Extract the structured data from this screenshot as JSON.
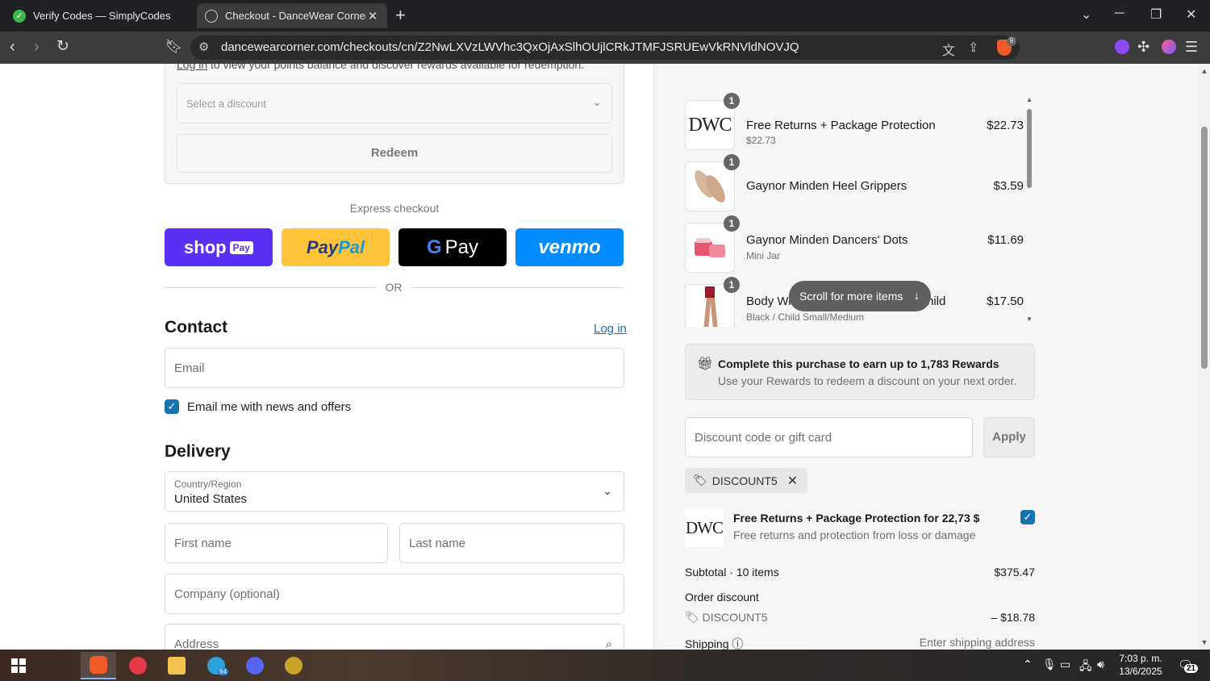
{
  "browser": {
    "tabs": [
      {
        "title": "Verify Codes — SimplyCodes",
        "active": false
      },
      {
        "title": "Checkout - DanceWear Corner",
        "active": true
      }
    ],
    "url": "dancewearcorner.com/checkouts/cn/Z2NwLXVzLWVhc3QxOjAxSlhOUjlCRkJTMFJSRUEwVkRNVldNOVJQ",
    "brave_badge": "9"
  },
  "left": {
    "points_text_link": "Log in",
    "points_text_rest": "to view your points balance and discover rewards available for redemption.",
    "select_discount_placeholder": "Select a discount",
    "redeem_label": "Redeem",
    "express_checkout_label": "Express checkout",
    "payment_buttons": {
      "shop": "shop",
      "shop_tag": "Pay",
      "paypal_a": "Pay",
      "paypal_b": "Pal",
      "gpay_g": "G",
      "gpay_text": "Pay",
      "venmo": "venmo"
    },
    "or_label": "OR",
    "contact_title": "Contact",
    "login_link": "Log in",
    "email_placeholder": "Email",
    "email_news_label": "Email me with news and offers",
    "delivery_title": "Delivery",
    "country_label": "Country/Region",
    "country_value": "United States",
    "first_name_placeholder": "First name",
    "last_name_placeholder": "Last name",
    "company_placeholder": "Company (optional)",
    "address_placeholder": "Address"
  },
  "summary": {
    "items": [
      {
        "qty": "1",
        "name": "Free Returns + Package Protection",
        "sub": "$22.73",
        "price": "$22.73",
        "thumb": "DWC"
      },
      {
        "qty": "1",
        "name": "Gaynor Minden Heel Grippers",
        "sub": "",
        "price": "$3.59",
        "thumb": "heel-grippers"
      },
      {
        "qty": "1",
        "name": "Gaynor Minden Dancers' Dots",
        "sub": "Mini Jar",
        "price": "$11.69",
        "thumb": "dots-jar"
      },
      {
        "qty": "1",
        "name": "Body Wrap",
        "name_tail": "hild",
        "sub": "Black / Child Small/Medium",
        "price": "$17.50",
        "thumb": "tights"
      }
    ],
    "scroll_pill": "Scroll for more items",
    "rewards_title": "Complete this purchase to earn up to 1,783 Rewards",
    "rewards_sub": "Use your Rewards to redeem a discount on your next order.",
    "discount_placeholder": "Discount code or gift card",
    "apply_label": "Apply",
    "applied_code": "DISCOUNT5",
    "protection_title": "Free Returns + Package Protection for 22,73 $",
    "protection_sub": "Free returns and protection from loss or damage",
    "protection_logo": "DWC",
    "subtotal_label": "Subtotal · 10 items",
    "subtotal_value": "$375.47",
    "order_discount_label": "Order discount",
    "order_discount_code": "DISCOUNT5",
    "order_discount_value": "– $18.78",
    "shipping_label": "Shipping",
    "shipping_value": "Enter shipping address"
  },
  "taskbar": {
    "time": "7:03 p. m.",
    "date": "13/6/2025",
    "notifications": "21",
    "telegram_badge": "94"
  },
  "colors": {
    "accent": "#1773b0",
    "shop_pay": "#5a31f4",
    "paypal": "#ffc439",
    "venmo": "#008cff"
  }
}
